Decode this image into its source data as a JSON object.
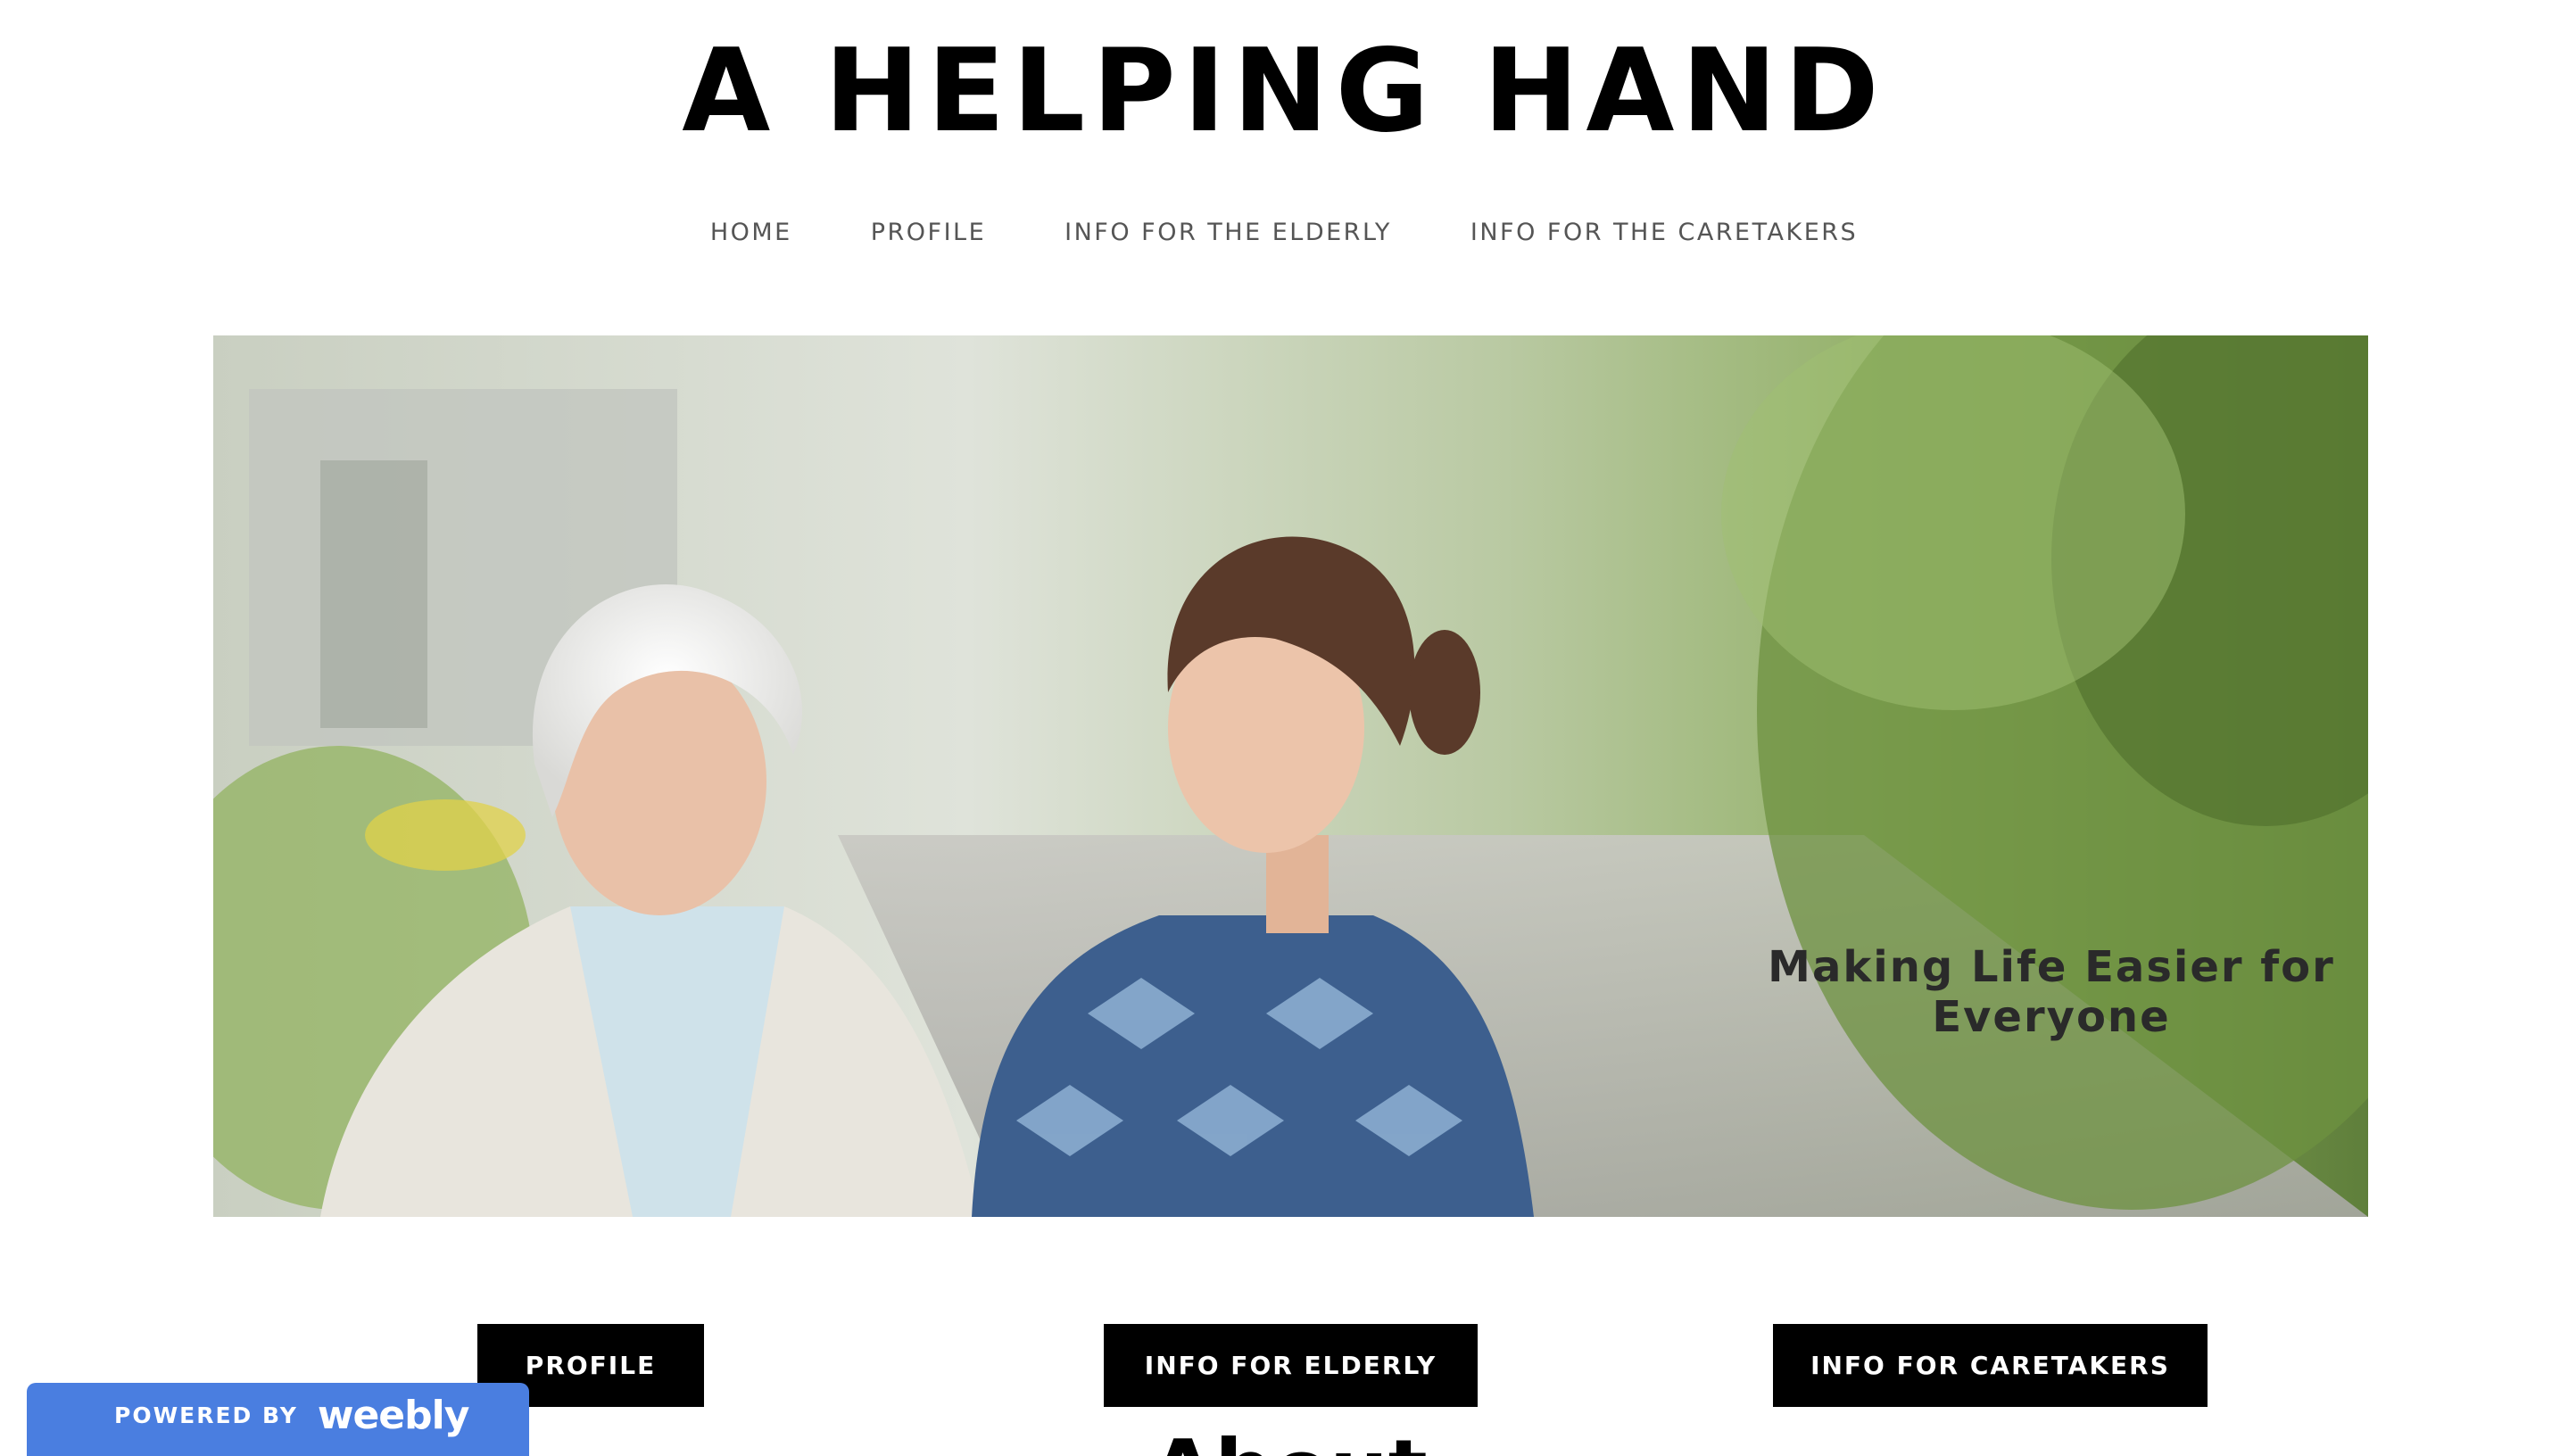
{
  "site": {
    "title": "A HELPING HAND"
  },
  "nav": {
    "items": [
      {
        "label": "HOME"
      },
      {
        "label": "PROFILE"
      },
      {
        "label": "INFO FOR THE ELDERLY"
      },
      {
        "label": "INFO FOR THE CARETAKERS"
      }
    ]
  },
  "hero": {
    "caption_line1": "Making Life Easier for",
    "caption_line2": "Everyone",
    "image_description_icon": "photo-elderly-woman-and-caretaker"
  },
  "cta": {
    "buttons": [
      {
        "label": "PROFILE"
      },
      {
        "label": "INFO FOR ELDERLY"
      },
      {
        "label": "INFO FOR CARETAKERS"
      }
    ]
  },
  "about": {
    "heading": "About"
  },
  "badge": {
    "powered_by": "POWERED BY",
    "brand": "weebly",
    "color": "#4a7ee0"
  }
}
